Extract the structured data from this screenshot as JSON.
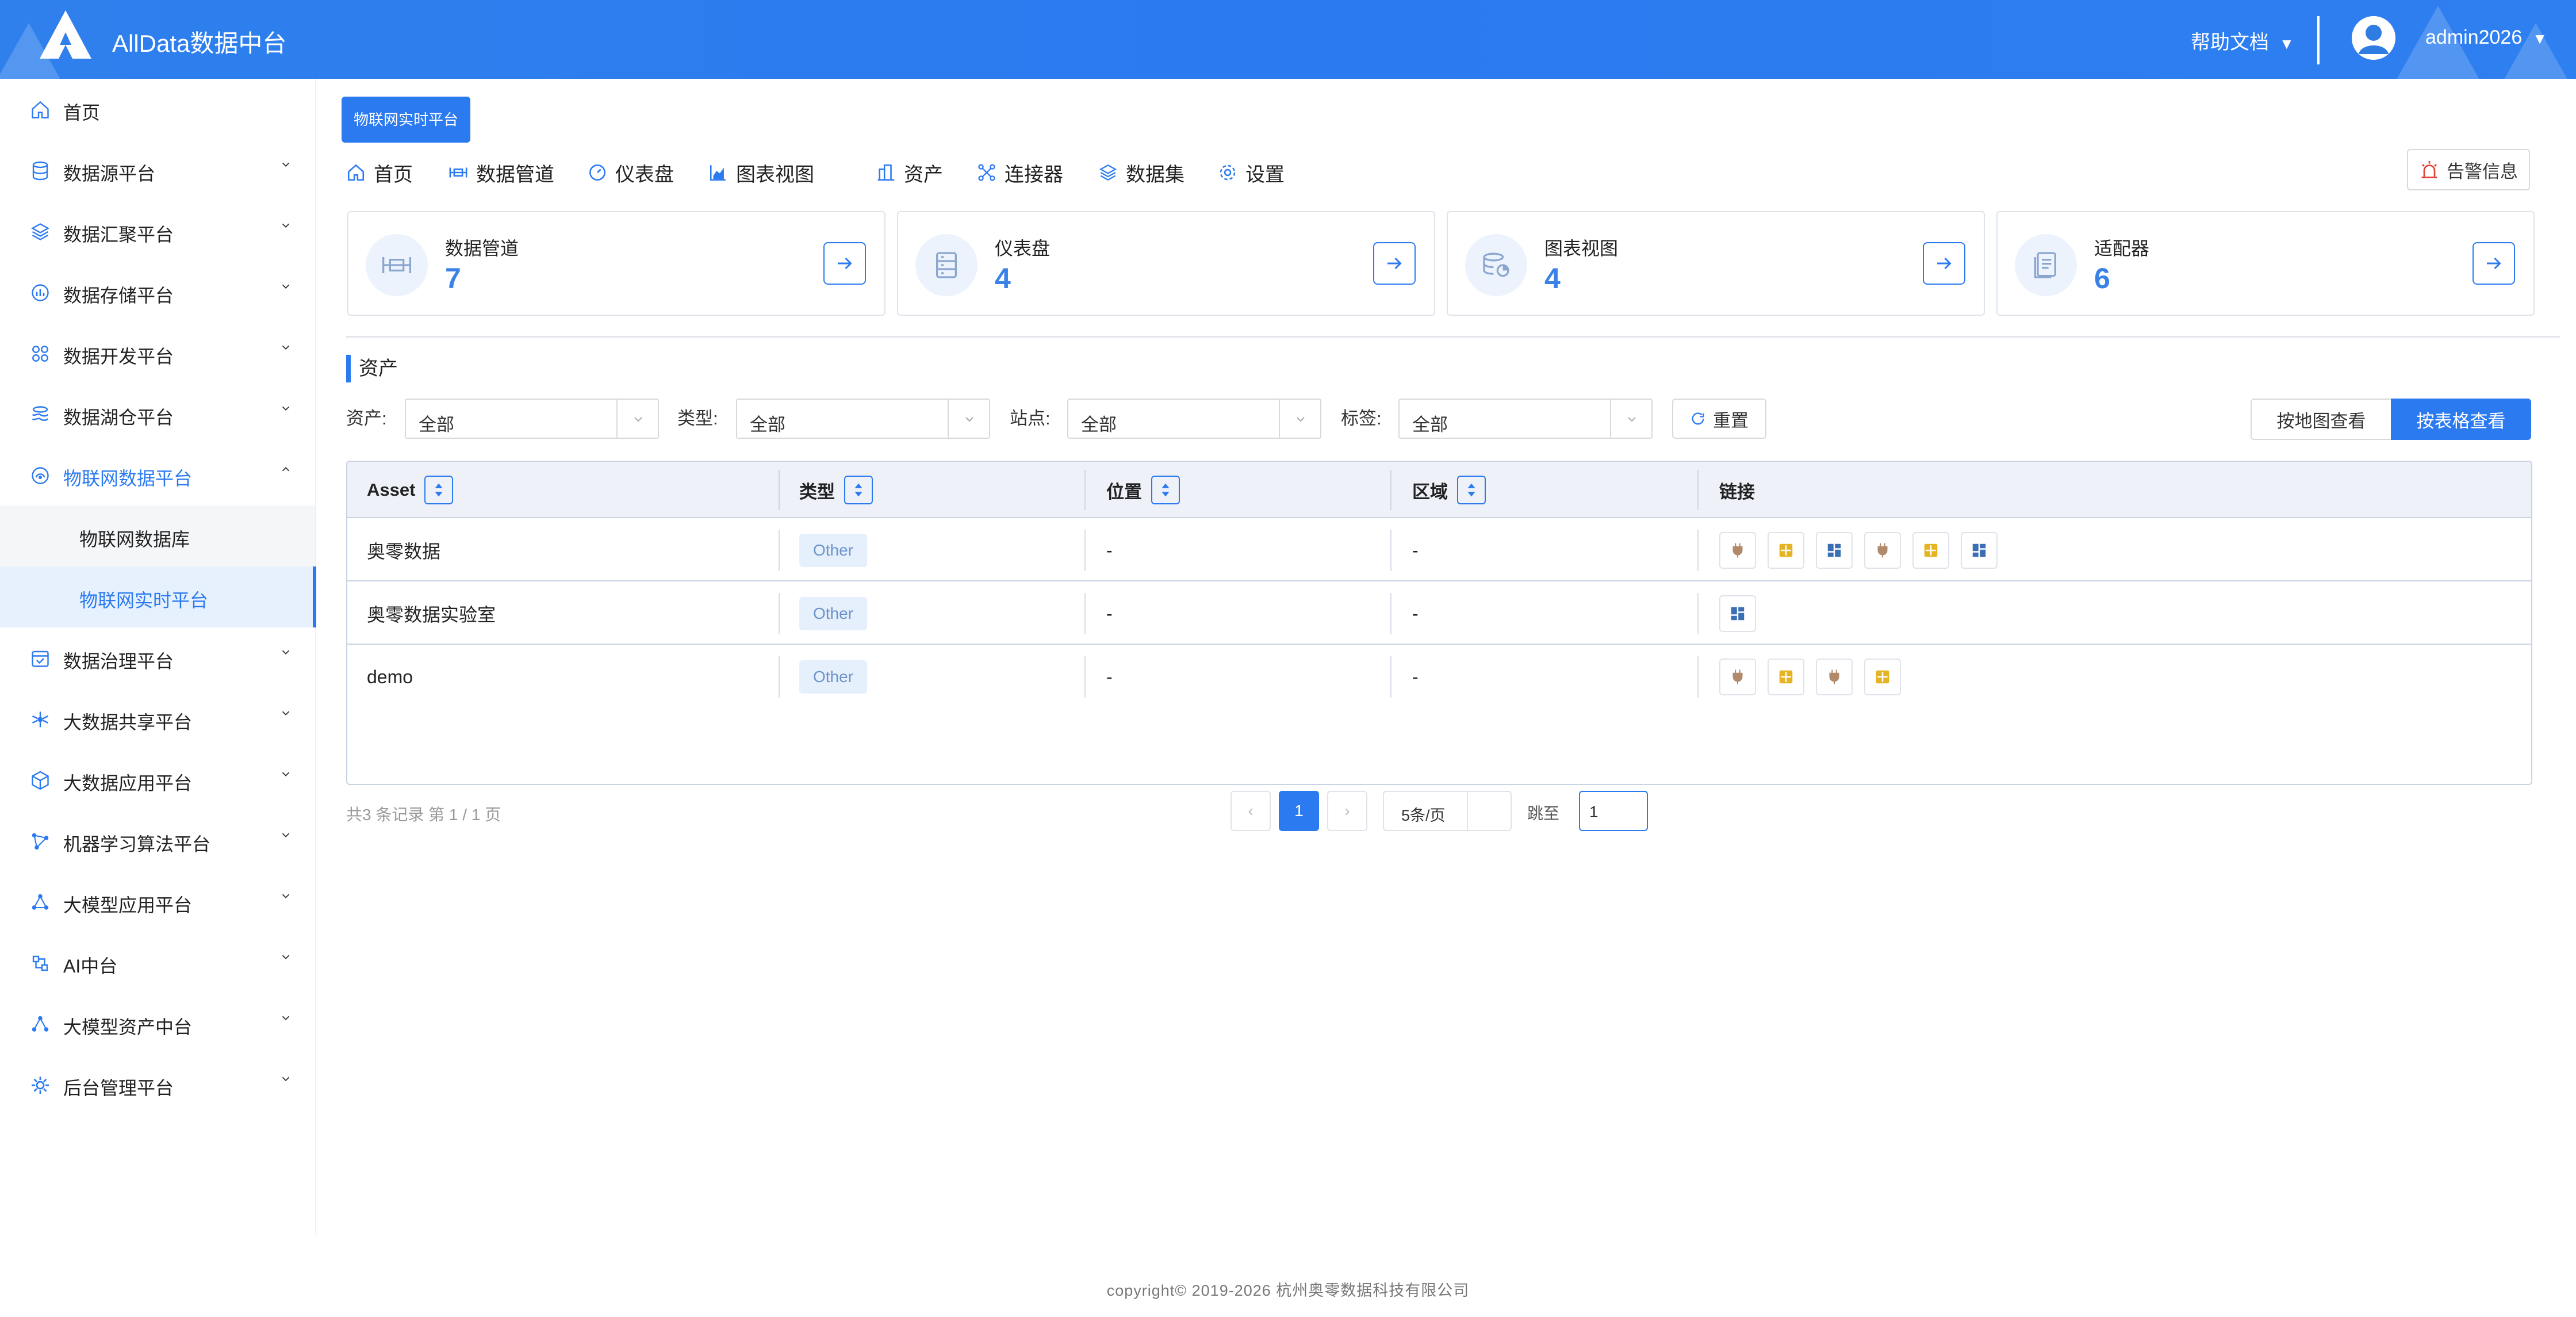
{
  "header": {
    "app_title": "AllData数据中台",
    "help_label": "帮助文档",
    "user_name": "admin2026"
  },
  "sidebar": {
    "items": [
      {
        "label": "首页",
        "icon": "home-icon"
      },
      {
        "label": "数据源平台",
        "icon": "database-icon"
      },
      {
        "label": "数据汇聚平台",
        "icon": "layers-icon"
      },
      {
        "label": "数据存储平台",
        "icon": "storage-icon"
      },
      {
        "label": "数据开发平台",
        "icon": "grid-icon"
      },
      {
        "label": "数据湖仓平台",
        "icon": "lake-icon"
      },
      {
        "label": "物联网数据平台",
        "icon": "iot-icon"
      },
      {
        "label": "数据治理平台",
        "icon": "governance-icon"
      },
      {
        "label": "大数据共享平台",
        "icon": "share-icon"
      },
      {
        "label": "大数据应用平台",
        "icon": "cube-icon"
      },
      {
        "label": "机器学习算法平台",
        "icon": "ml-icon"
      },
      {
        "label": "大模型应用平台",
        "icon": "model-icon"
      },
      {
        "label": "AI中台",
        "icon": "ai-icon"
      },
      {
        "label": "大模型资产中台",
        "icon": "asset-icon"
      },
      {
        "label": "后台管理平台",
        "icon": "admin-icon"
      }
    ],
    "sub_items": [
      {
        "label": "物联网数据库"
      },
      {
        "label": "物联网实时平台"
      }
    ]
  },
  "main": {
    "platform_tag": "物联网实时平台",
    "tabs": [
      {
        "label": "首页",
        "icon": "home-icon"
      },
      {
        "label": "数据管道",
        "icon": "pipeline-icon"
      },
      {
        "label": "仪表盘",
        "icon": "dashboard-icon"
      },
      {
        "label": "图表视图",
        "icon": "chart-icon"
      },
      {
        "label": "资产",
        "icon": "asset-icon"
      },
      {
        "label": "连接器",
        "icon": "connector-icon"
      },
      {
        "label": "数据集",
        "icon": "dataset-icon"
      },
      {
        "label": "设置",
        "icon": "gear-icon"
      }
    ],
    "alert_label": "告警信息",
    "stats": [
      {
        "label": "数据管道",
        "value": "7",
        "icon": "pipeline-icon"
      },
      {
        "label": "仪表盘",
        "value": "4",
        "icon": "server-icon"
      },
      {
        "label": "图表视图",
        "value": "4",
        "icon": "db-chart-icon"
      },
      {
        "label": "适配器",
        "value": "6",
        "icon": "document-icon"
      }
    ],
    "section_title": "资产",
    "filters": [
      {
        "label": "资产:",
        "value": "全部"
      },
      {
        "label": "类型:",
        "value": "全部"
      },
      {
        "label": "站点:",
        "value": "全部"
      },
      {
        "label": "标签:",
        "value": "全部"
      }
    ],
    "reset_label": "重置",
    "view_map_label": "按地图查看",
    "view_table_label": "按表格查看",
    "table": {
      "columns": [
        "Asset",
        "类型",
        "位置",
        "区域",
        "链接"
      ],
      "rows": [
        {
          "asset": "奥零数据",
          "type": "Other",
          "location": "-",
          "region": "-",
          "links": [
            "plug-icon",
            "grid-icon",
            "dashboard-icon",
            "plug-icon",
            "grid-icon",
            "dashboard-icon"
          ]
        },
        {
          "asset": "奥零数据实验室",
          "type": "Other",
          "location": "-",
          "region": "-",
          "links": [
            "dashboard-icon"
          ]
        },
        {
          "asset": "demo",
          "type": "Other",
          "location": "-",
          "region": "-",
          "links": [
            "plug-icon",
            "grid-icon",
            "plug-icon",
            "grid-icon"
          ]
        }
      ]
    },
    "pagination": {
      "total_text": "共3 条记录 第 1 / 1 页",
      "prev": "‹",
      "current_page": "1",
      "next": "›",
      "page_size": "5条/页",
      "jump_label": "跳至",
      "jump_value": "1"
    }
  },
  "footer": {
    "copyright": "copyright© 2019-2026 杭州奥零数据科技有限公司"
  },
  "colors": {
    "accent": "#2b7af0",
    "header_bg": "#2f80ed",
    "plug_icon": "#b08a6a",
    "grid_icon": "#e6b422",
    "dashboard_icon": "#3b6fb5"
  }
}
